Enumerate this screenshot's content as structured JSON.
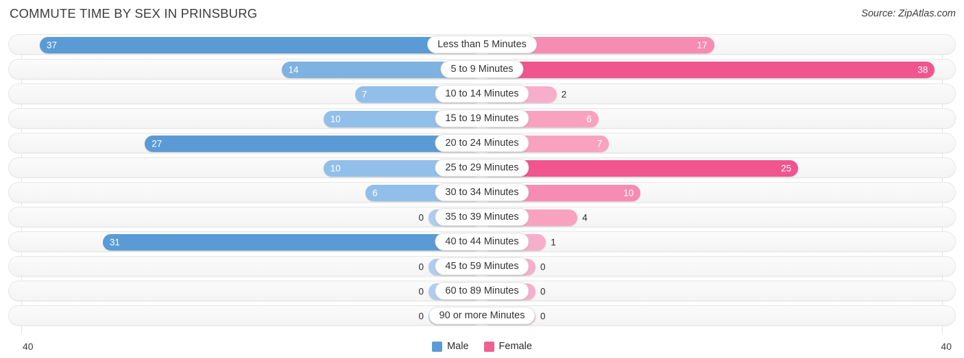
{
  "header": {
    "title": "COMMUTE TIME BY SEX IN PRINSBURG",
    "source": "Source: ZipAtlas.com"
  },
  "axis": {
    "left_tick": "40",
    "right_tick": "40"
  },
  "legend": {
    "items": [
      {
        "label": "Male",
        "color": "#5b9bd5"
      },
      {
        "label": "Female",
        "color": "#ef5f92"
      }
    ]
  },
  "chart_data": {
    "type": "bar",
    "title": "COMMUTE TIME BY SEX IN PRINSBURG",
    "subtitle": "Source: ZipAtlas.com",
    "orientation": "horizontal-diverging",
    "xlabel": "",
    "ylabel": "",
    "xlim": [
      40,
      40
    ],
    "axis_ticks": [
      "40",
      "40"
    ],
    "grid": true,
    "legend_position": "bottom-center",
    "categories": [
      "Less than 5 Minutes",
      "5 to 9 Minutes",
      "10 to 14 Minutes",
      "15 to 19 Minutes",
      "20 to 24 Minutes",
      "25 to 29 Minutes",
      "30 to 34 Minutes",
      "35 to 39 Minutes",
      "40 to 44 Minutes",
      "45 to 59 Minutes",
      "60 to 89 Minutes",
      "90 or more Minutes"
    ],
    "series": [
      {
        "name": "Male",
        "color": "#5b9bd5",
        "side": "left",
        "values": [
          37,
          14,
          7,
          10,
          27,
          10,
          6,
          0,
          31,
          0,
          0,
          0
        ]
      },
      {
        "name": "Female",
        "color": "#ef5f92",
        "side": "right",
        "values": [
          17,
          38,
          2,
          6,
          7,
          25,
          10,
          4,
          1,
          0,
          0,
          0
        ]
      }
    ]
  },
  "rows": [
    {
      "label": "Less than 5 Minutes",
      "male": "37",
      "female": "17"
    },
    {
      "label": "5 to 9 Minutes",
      "male": "14",
      "female": "38"
    },
    {
      "label": "10 to 14 Minutes",
      "male": "7",
      "female": "2"
    },
    {
      "label": "15 to 19 Minutes",
      "male": "10",
      "female": "6"
    },
    {
      "label": "20 to 24 Minutes",
      "male": "27",
      "female": "7"
    },
    {
      "label": "25 to 29 Minutes",
      "male": "10",
      "female": "25"
    },
    {
      "label": "30 to 34 Minutes",
      "male": "6",
      "female": "10"
    },
    {
      "label": "35 to 39 Minutes",
      "male": "0",
      "female": "4"
    },
    {
      "label": "40 to 44 Minutes",
      "male": "31",
      "female": "1"
    },
    {
      "label": "45 to 59 Minutes",
      "male": "0",
      "female": "0"
    },
    {
      "label": "60 to 89 Minutes",
      "male": "0",
      "female": "0"
    },
    {
      "label": "90 or more Minutes",
      "male": "0",
      "female": "0"
    }
  ]
}
